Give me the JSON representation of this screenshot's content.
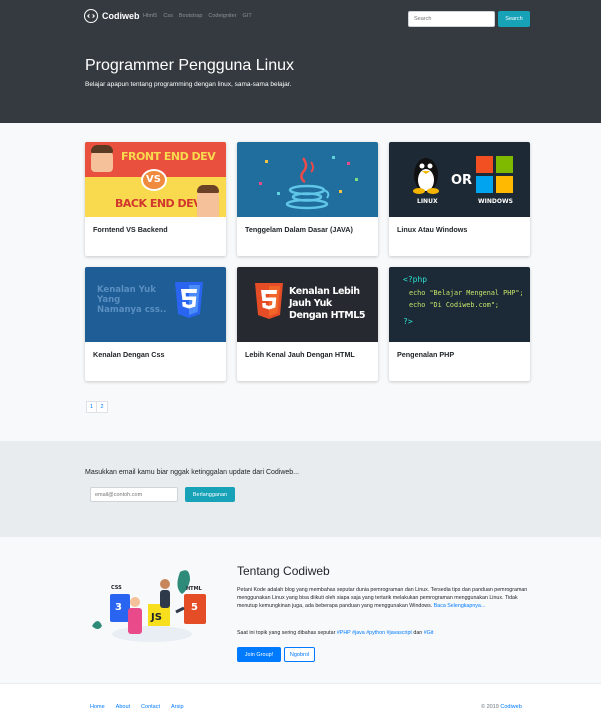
{
  "navbar": {
    "brand": "Codiweb",
    "links": [
      "Html5",
      "Css",
      "Bootstrap",
      "Codeigniter",
      "GIT"
    ],
    "search_placeholder": "Search",
    "search_button": "Search"
  },
  "hero": {
    "title": "Programmer Pengguna Linux",
    "subtitle": "Belajar apapun tentang programming dengan linux, sama-sama belajar."
  },
  "cards": [
    {
      "title": "Forntend VS Backend",
      "thumb": {
        "top": "FRONT END DEV",
        "mid": "VS",
        "bottom": "BACK END DEV"
      }
    },
    {
      "title": "Tenggelam Dalam Dasar (JAVA)",
      "thumb": {
        "icon": "java-cup-icon"
      }
    },
    {
      "title": "Linux Atau Windows",
      "thumb": {
        "left": "LINUX",
        "mid": "OR",
        "right": "WINDOWS"
      }
    },
    {
      "title": "Kenalan Dengan Css",
      "thumb": {
        "text": "Kenalan Yuk Yang Namanya css..",
        "icon": "css3-icon"
      }
    },
    {
      "title": "Lebih Kenal Jauh Dengan HTML",
      "thumb": {
        "text": "Kenalan Lebih Jauh Yuk Dengan HTML5",
        "icon": "html5-icon"
      }
    },
    {
      "title": "Pengenalan PHP",
      "thumb": {
        "line1": "<?php",
        "line2": "echo \"Belajar Mengenal PHP\";",
        "line3": "echo \"Di Codiweb.com\";",
        "line4": "?>"
      }
    }
  ],
  "pagination": [
    "1",
    "2"
  ],
  "newsletter": {
    "text": "Masukkan email kamu biar nggak ketinggalan update dari Codiweb...",
    "placeholder": "email@contoh.com",
    "button": "Berlangganan"
  },
  "about": {
    "title": "Tentang Codiweb",
    "body": "Petani Kode adalah blog yang membahas seputar dunia pemrograman dan Linux. Tersedia tips dan panduan pemrograman menggunakan Linux yang bisa diikuti oleh siapa saja yang tertarik melakukan pemrograman menggunakan Linux. Tidak menutup kemungkinan juga, ada beberapa panduan yang menggunakan Windows.",
    "read_more": "Baca Selengkapnya...",
    "tags_prefix": "Saat ini topik yang sering dibahas seputar",
    "tags": [
      "#PHP",
      "#java",
      "#python",
      "#javascript"
    ],
    "tags_joiner": "dan",
    "tags_last": "#Git",
    "join_button": "Join Group!",
    "chat_button": "Ngobrol",
    "illus": {
      "css": "CSS",
      "html": "HTML",
      "js": "JS"
    }
  },
  "footer": {
    "links": [
      "Home",
      "About",
      "Contact",
      "Arsip"
    ],
    "copyright_prefix": "© 2019",
    "copyright_brand": "Codiweb"
  },
  "colors": {
    "dark": "#343a40",
    "accent_teal": "#17a2b8",
    "link_blue": "#007bff",
    "light_bg": "#f8f9fa"
  }
}
